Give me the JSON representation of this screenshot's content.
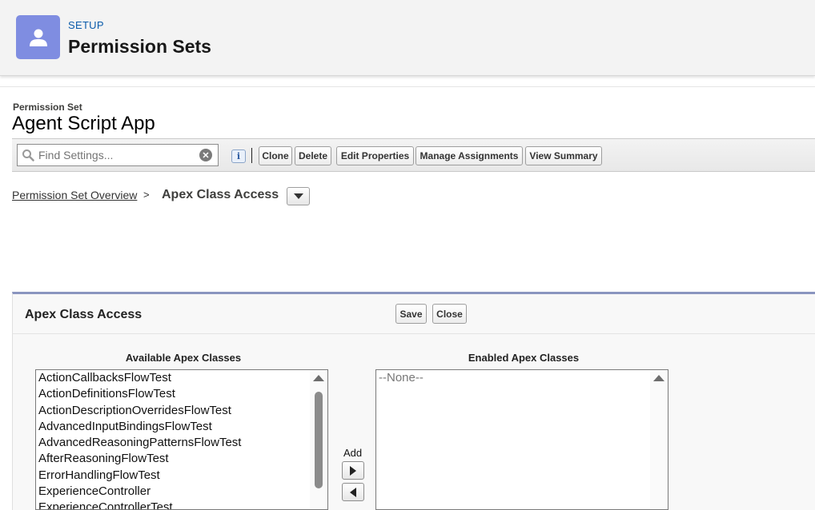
{
  "header": {
    "eyebrow": "SETUP",
    "title": "Permission Sets",
    "icon": "user-icon",
    "icon_color": "#7f8de1"
  },
  "permission_set": {
    "label": "Permission Set",
    "name": "Agent Script App"
  },
  "toolbar": {
    "search_placeholder": "Find Settings...",
    "search_value": "",
    "info_icon": "i",
    "clear_icon": "✕",
    "buttons": {
      "clone": "Clone",
      "delete": "Delete",
      "edit_properties": "Edit Properties",
      "manage_assignments": "Manage Assignments",
      "view_summary": "View Summary"
    }
  },
  "breadcrumb": {
    "parent": "Permission Set Overview",
    "separator": ">",
    "current": "Apex Class Access"
  },
  "section": {
    "title": "Apex Class Access",
    "save_label": "Save",
    "close_label": "Close",
    "available_label": "Available Apex Classes",
    "enabled_label": "Enabled Apex Classes",
    "add_label": "Add",
    "available_classes": [
      "ActionCallbacksFlowTest",
      "ActionDefinitionsFlowTest",
      "ActionDescriptionOverridesFlowTest",
      "AdvancedInputBindingsFlowTest",
      "AdvancedReasoningPatternsFlowTest",
      "AfterReasoningFlowTest",
      "ErrorHandlingFlowTest",
      "ExperienceController",
      "ExperienceControllerTest"
    ],
    "enabled_classes": [
      "--None--"
    ]
  },
  "colors": {
    "accent_blue": "#0b5cab",
    "panel_border": "#8a95bf"
  }
}
